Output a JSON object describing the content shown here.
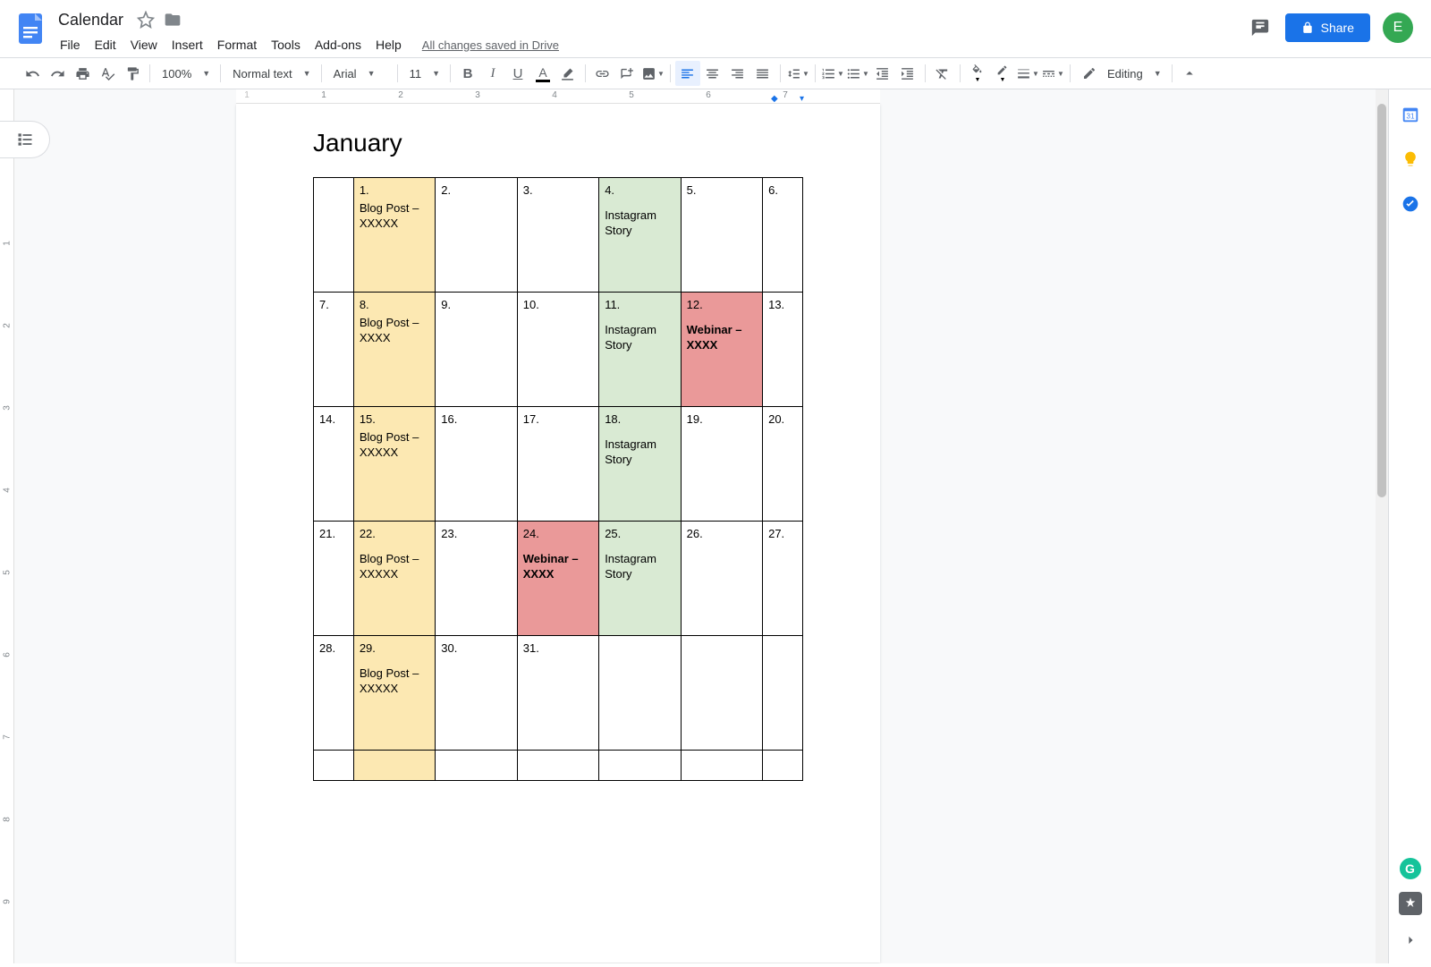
{
  "doc": {
    "title": "Calendar",
    "save_state": "All changes saved in Drive"
  },
  "user": {
    "avatar_letter": "E"
  },
  "menu": {
    "file": "File",
    "edit": "Edit",
    "view": "View",
    "insert": "Insert",
    "format": "Format",
    "tools": "Tools",
    "addons": "Add-ons",
    "help": "Help"
  },
  "toolbar": {
    "zoom": "100%",
    "style": "Normal text",
    "font": "Arial",
    "size": "11",
    "mode": "Editing"
  },
  "share_label": "Share",
  "ruler_h": [
    "1",
    "2",
    "3",
    "4",
    "5",
    "6",
    "7"
  ],
  "ruler_v": [
    "1",
    "2",
    "3",
    "4",
    "5",
    "6",
    "7",
    "8",
    "9"
  ],
  "content": {
    "heading": "January",
    "rows": [
      [
        {
          "num": "",
          "text": "",
          "color": ""
        },
        {
          "num": "1.",
          "text": "Blog Post  – XXXXX",
          "tight": true,
          "color": "yellow"
        },
        {
          "num": "2.",
          "text": "",
          "color": ""
        },
        {
          "num": "3.",
          "text": "",
          "color": ""
        },
        {
          "num": "4.",
          "text": "Instagram Story",
          "color": "green"
        },
        {
          "num": "5.",
          "text": "",
          "color": ""
        },
        {
          "num": "6.",
          "text": "",
          "color": ""
        }
      ],
      [
        {
          "num": "7.",
          "text": "",
          "color": ""
        },
        {
          "num": "8.",
          "text": "Blog Post  – XXXX",
          "tight": true,
          "color": "yellow"
        },
        {
          "num": "9.",
          "text": "",
          "color": ""
        },
        {
          "num": "10.",
          "text": "",
          "color": ""
        },
        {
          "num": "11.",
          "text": "Instagram Story",
          "color": "green"
        },
        {
          "num": "12.",
          "text": "Webinar – XXXX",
          "bold": true,
          "color": "red"
        },
        {
          "num": "13.",
          "text": "",
          "color": ""
        }
      ],
      [
        {
          "num": "14.",
          "text": "",
          "color": ""
        },
        {
          "num": "15.",
          "text": "Blog Post  – XXXXX",
          "tight": true,
          "color": "yellow"
        },
        {
          "num": "16.",
          "text": "",
          "color": ""
        },
        {
          "num": "17.",
          "text": "",
          "color": ""
        },
        {
          "num": "18.",
          "text": "Instagram Story",
          "color": "green"
        },
        {
          "num": "19.",
          "text": "",
          "color": ""
        },
        {
          "num": "20.",
          "text": "",
          "color": ""
        }
      ],
      [
        {
          "num": "21.",
          "text": "",
          "color": ""
        },
        {
          "num": "22.",
          "text": "Blog Post  – XXXXX",
          "color": "yellow"
        },
        {
          "num": "23.",
          "text": "",
          "color": ""
        },
        {
          "num": "24.",
          "text": "Webinar – XXXX",
          "bold": true,
          "color": "red"
        },
        {
          "num": "25.",
          "text": "Instagram Story",
          "color": "green"
        },
        {
          "num": "26.",
          "text": "",
          "color": ""
        },
        {
          "num": "27.",
          "text": "",
          "color": ""
        }
      ],
      [
        {
          "num": "28.",
          "text": "",
          "color": ""
        },
        {
          "num": "29.",
          "text": "Blog Post  – XXXXX",
          "color": "yellow"
        },
        {
          "num": "30.",
          "text": "",
          "color": ""
        },
        {
          "num": "31.",
          "text": "",
          "color": ""
        },
        {
          "num": "",
          "text": "",
          "color": ""
        },
        {
          "num": "",
          "text": "",
          "color": ""
        },
        {
          "num": "",
          "text": "",
          "color": ""
        }
      ],
      [
        {
          "num": "",
          "text": "",
          "short": true
        },
        {
          "num": "",
          "text": "",
          "short": true,
          "color": "yellow"
        },
        {
          "num": "",
          "text": "",
          "short": true
        },
        {
          "num": "",
          "text": "",
          "short": true
        },
        {
          "num": "",
          "text": "",
          "short": true
        },
        {
          "num": "",
          "text": "",
          "short": true
        },
        {
          "num": "",
          "text": "",
          "short": true
        }
      ]
    ]
  }
}
